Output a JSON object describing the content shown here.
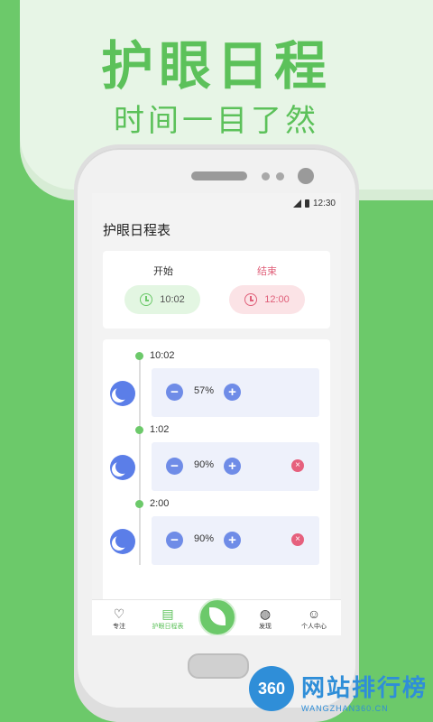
{
  "hero": {
    "title": "护眼日程",
    "subtitle": "时间一目了然"
  },
  "status_bar": {
    "time": "12:30"
  },
  "app": {
    "title": "护眼日程表"
  },
  "time_range": {
    "start": {
      "label": "开始",
      "value": "10:02"
    },
    "end": {
      "label": "结束",
      "value": "12:00"
    }
  },
  "schedule": [
    {
      "time": "10:02",
      "brightness": "57%",
      "deletable": false
    },
    {
      "time": "1:02",
      "brightness": "90%",
      "deletable": true
    },
    {
      "time": "2:00",
      "brightness": "90%",
      "deletable": true
    }
  ],
  "controls": {
    "minus": "−",
    "plus": "+",
    "delete": "×"
  },
  "tabs": [
    {
      "label": "专注",
      "icon": "heart-icon",
      "active": false
    },
    {
      "label": "护眼日程表",
      "icon": "calendar-icon",
      "active": true
    },
    {
      "label": "发现",
      "icon": "planet-icon",
      "active": false
    },
    {
      "label": "个人中心",
      "icon": "user-icon",
      "active": false
    }
  ],
  "watermark": {
    "logo": "360",
    "text": "网站排行榜",
    "sub": "WANGZHAN360.CN"
  },
  "colors": {
    "accent": "#6cc96a",
    "danger": "#e6607d",
    "button_blue": "#6f8ce7",
    "moon": "#5b7ee8"
  }
}
